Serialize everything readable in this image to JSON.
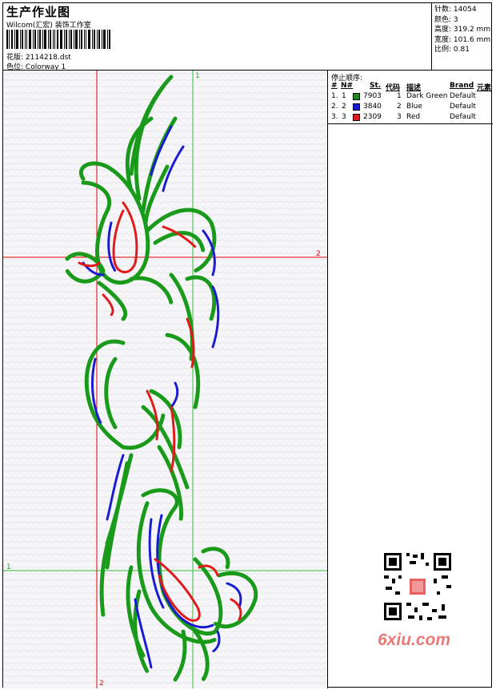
{
  "header": {
    "title": "生产作业图",
    "subtitle": "Wilcom(汇宏) 装饰工作室",
    "design_label": "花版:",
    "design_value": "2114218.dst",
    "colorway_label": "色位:",
    "colorway_value": "Colorway 1"
  },
  "stats": {
    "stitches_label": "针数:",
    "stitches_value": "14054",
    "colors_label": "颜色:",
    "colors_value": "3",
    "height_label": "高度:",
    "height_value": "319.2 mm",
    "width_label": "宽度:",
    "width_value": "101.6 mm",
    "scale_label": "比例:",
    "scale_value": "0.81"
  },
  "guides": {
    "h_top_label": "2",
    "h_bottom_label": "1",
    "v_green_label": "1",
    "v_red_label": "2"
  },
  "panel": {
    "title": "停止顺序:",
    "columns": [
      "#",
      "N#",
      "St.",
      "代码",
      "描述",
      "Brand",
      "元素"
    ],
    "rows": [
      {
        "index": "1.",
        "n": "1",
        "color": "#1a8a1a",
        "stitch": "7903",
        "code": "1",
        "desc": "Dark Green",
        "brand": "Default"
      },
      {
        "index": "2.",
        "n": "2",
        "color": "#1a1ad0",
        "stitch": "3840",
        "code": "2",
        "desc": "Blue",
        "brand": "Default"
      },
      {
        "index": "3.",
        "n": "3",
        "color": "#e01a1a",
        "stitch": "2309",
        "code": "3",
        "desc": "Red",
        "brand": "Default"
      }
    ]
  },
  "colors": {
    "green": "#1a9a1a",
    "blue": "#1a1ad0",
    "red": "#e01a1a",
    "guide_red": "#e00000",
    "guide_green": "#30c030"
  },
  "watermark": {
    "text": "6xiu.com"
  },
  "icons": [
    "barcode-icon",
    "qr-code-icon"
  ]
}
